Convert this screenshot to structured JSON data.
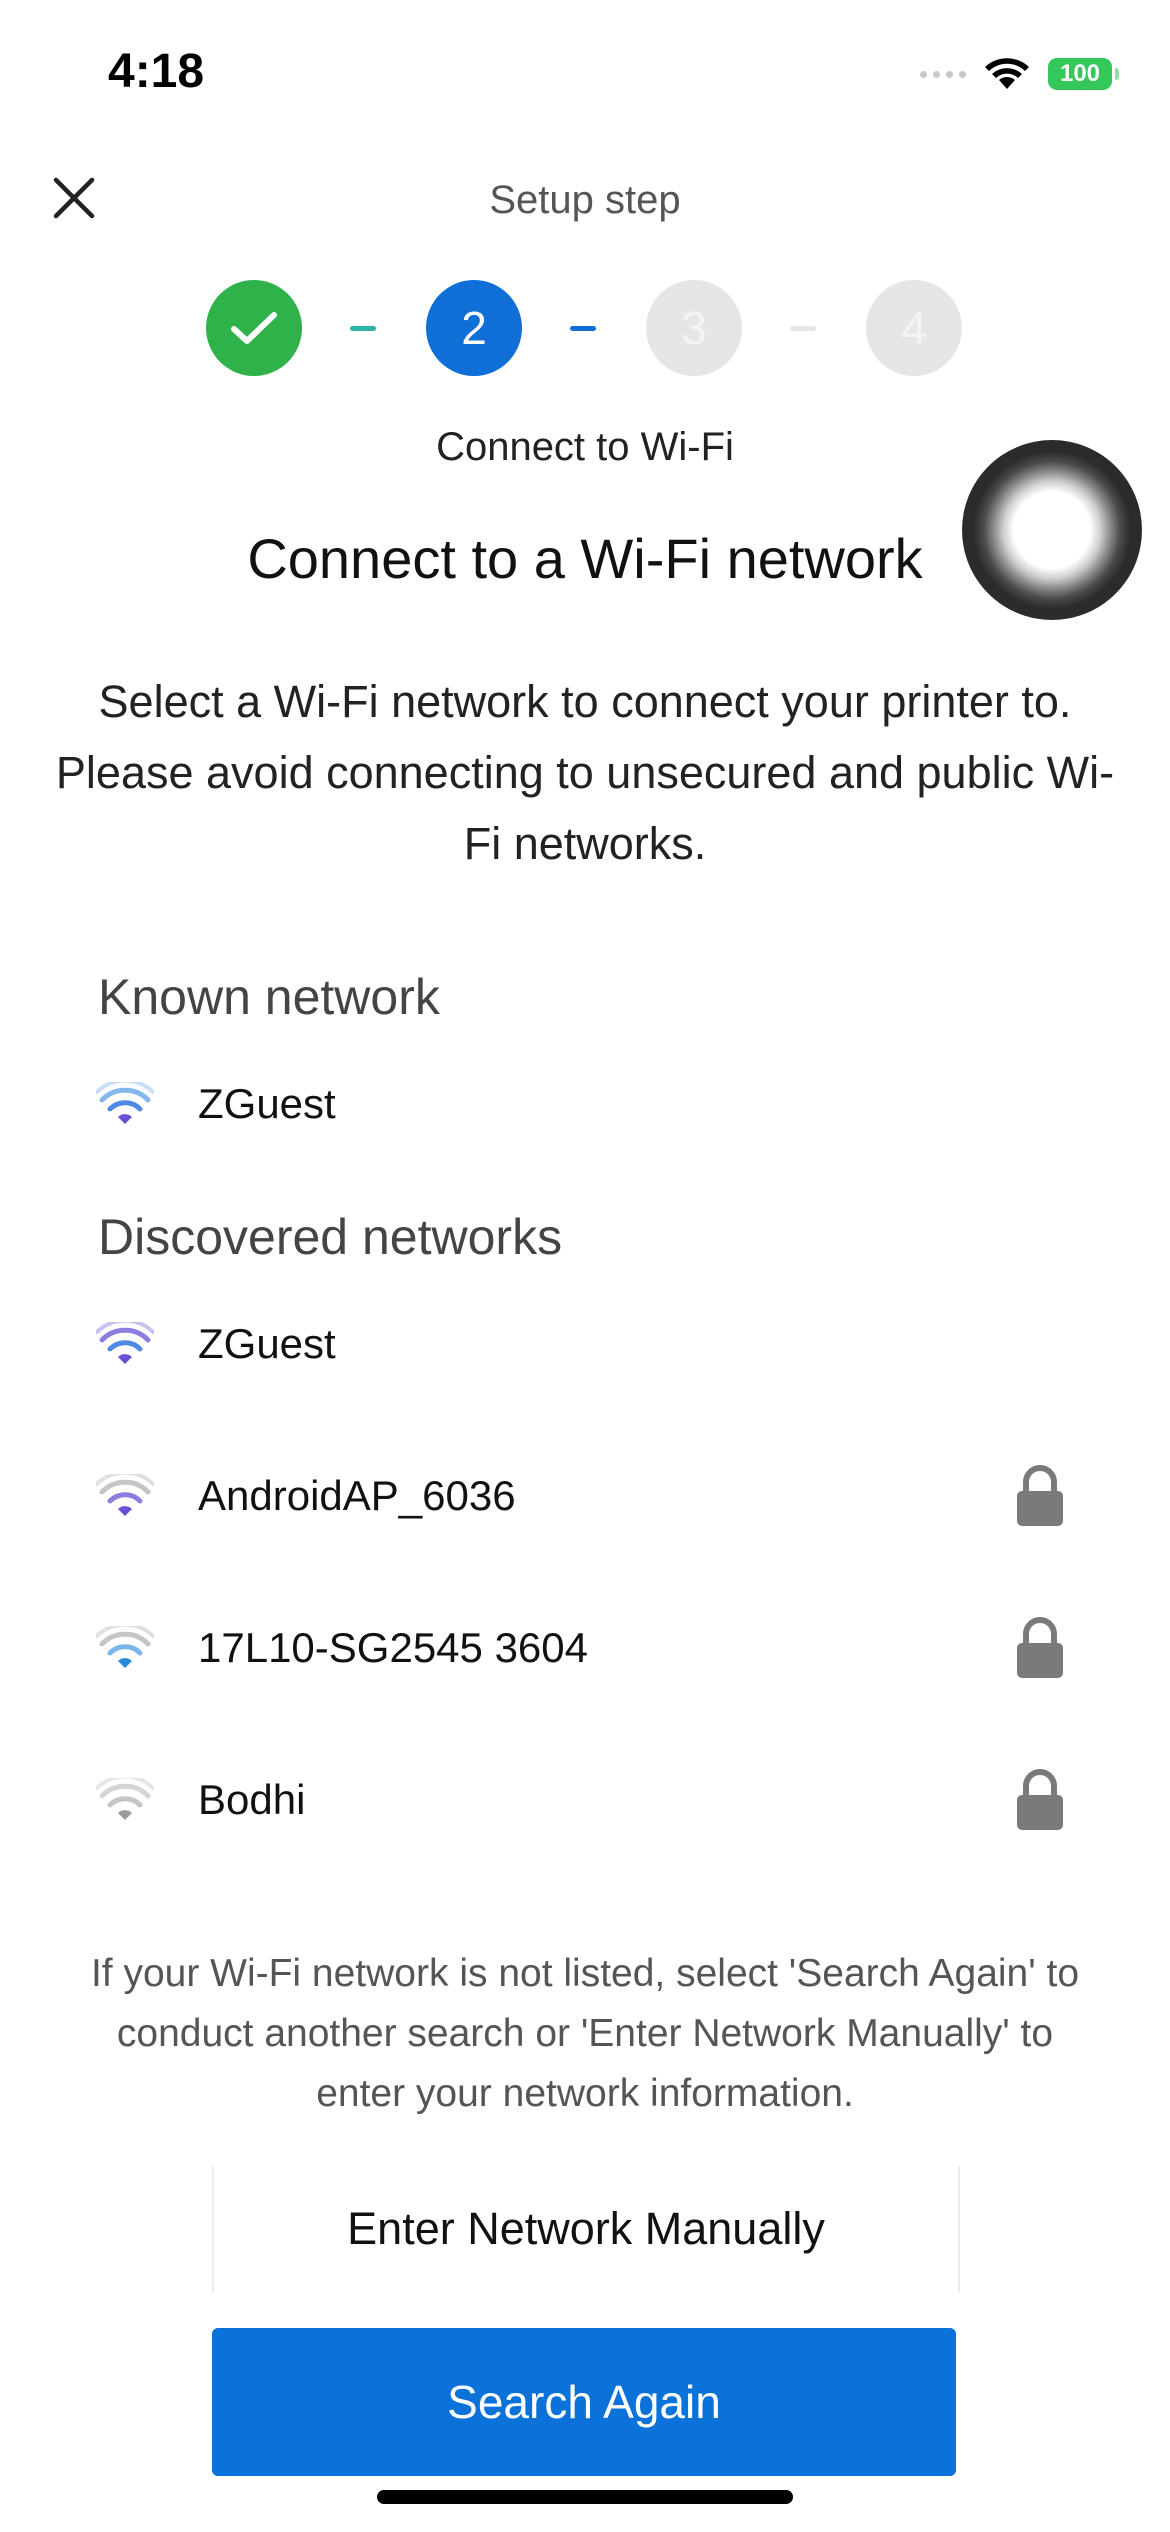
{
  "status_bar": {
    "time": "4:18",
    "battery": "100",
    "icons": [
      "cellular-dots-icon",
      "wifi-icon",
      "battery-icon"
    ]
  },
  "header": {
    "title": "Setup step",
    "close_icon": "close-icon"
  },
  "stepper": {
    "steps": [
      {
        "label": "",
        "state": "completed",
        "icon": "checkmark-icon"
      },
      {
        "label": "2",
        "state": "active"
      },
      {
        "label": "3",
        "state": "upcoming"
      },
      {
        "label": "4",
        "state": "upcoming"
      }
    ],
    "current_step_label": "Connect to Wi-Fi"
  },
  "main": {
    "heading": "Connect to a Wi-Fi network",
    "description": "Select a Wi-Fi network to connect your printer to. Please avoid connecting to unsecured and public Wi-Fi networks."
  },
  "known_networks": {
    "heading": "Known network",
    "items": [
      {
        "name": "ZGuest",
        "secured": false,
        "signal_icon": "wifi-icon"
      }
    ]
  },
  "discovered_networks": {
    "heading": "Discovered networks",
    "items": [
      {
        "name": "ZGuest",
        "secured": false,
        "signal_icon": "wifi-icon"
      },
      {
        "name": "AndroidAP_6036",
        "secured": true,
        "signal_icon": "wifi-icon",
        "lock_icon": "lock-icon"
      },
      {
        "name": "17L10-SG2545 3604",
        "secured": true,
        "signal_icon": "wifi-icon",
        "lock_icon": "lock-icon"
      },
      {
        "name": "Bodhi",
        "secured": true,
        "signal_icon": "wifi-icon",
        "lock_icon": "lock-icon"
      }
    ]
  },
  "footer": {
    "note": "If your Wi-Fi network is not listed, select 'Search Again' to conduct another search or 'Enter Network Manually' to enter your network information.",
    "manual_button": "Enter Network Manually",
    "search_button": "Search Again"
  },
  "colors": {
    "primary_blue": "#0a72d8",
    "success_green": "#2fb24a",
    "inactive_gray": "#e6e6e6",
    "battery_green": "#34c759"
  }
}
